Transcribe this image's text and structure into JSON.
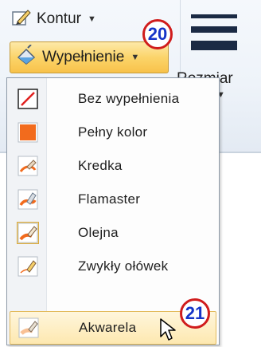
{
  "ribbon": {
    "outline": {
      "label": "Kontur",
      "icon": "pencil-outline-icon"
    },
    "fill": {
      "label": "Wypełnienie",
      "icon": "paint-bucket-icon"
    },
    "size": {
      "label": "Rozmiar",
      "icon": "line-thickness-icon"
    }
  },
  "badges": {
    "first": "20",
    "second": "21"
  },
  "menu": {
    "items": [
      {
        "label": "Bez wypełnienia",
        "icon": "no-fill-icon"
      },
      {
        "label": "Pełny kolor",
        "icon": "solid-color-icon"
      },
      {
        "label": "Kredka",
        "icon": "crayon-icon"
      },
      {
        "label": "Flamaster",
        "icon": "marker-icon"
      },
      {
        "label": "Olejna",
        "icon": "oil-paint-icon",
        "checked": true
      },
      {
        "label": "Zwykły ołówek",
        "icon": "pencil-icon"
      },
      {
        "label": "Akwarela",
        "icon": "watercolor-icon",
        "hovered": true
      }
    ]
  },
  "colors": {
    "accent_orange": "#f26b1d",
    "no_fill_red": "#e0201f",
    "badge_ring": "#d01c1c",
    "badge_text": "#1534c8",
    "highlight": "#fbd46a"
  }
}
